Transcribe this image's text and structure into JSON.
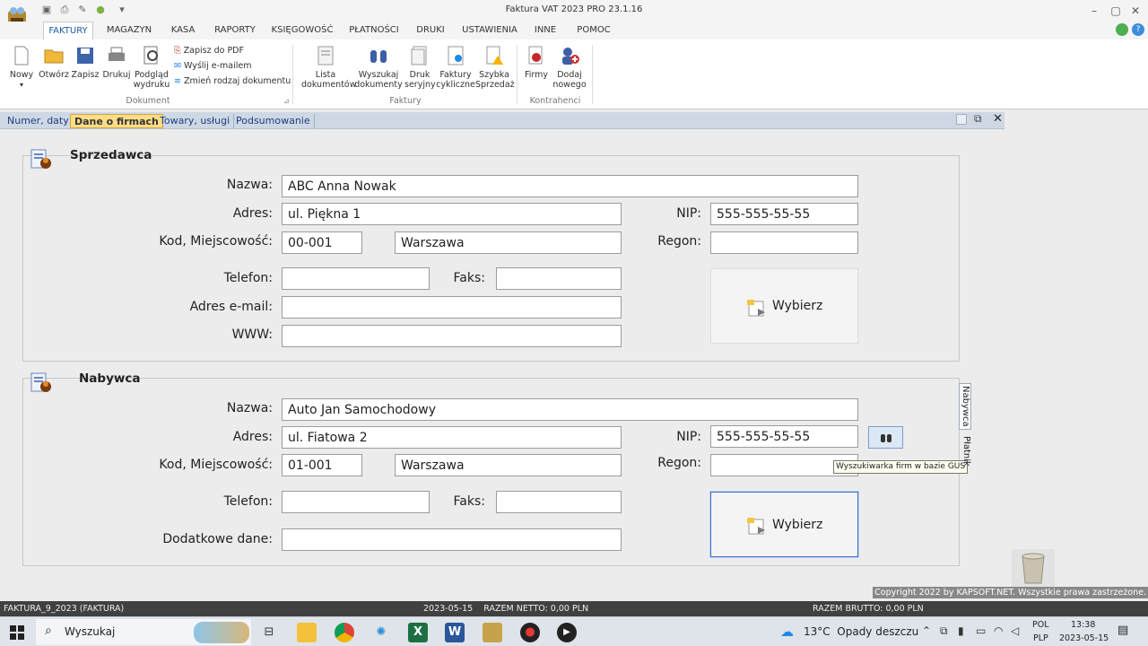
{
  "window": {
    "title": "Faktura VAT 2023 PRO 23.1.16"
  },
  "menu": [
    "FAKTURY",
    "MAGAZYN",
    "KASA",
    "RAPORTY",
    "KSIĘGOWOŚĆ",
    "PŁATNOŚCI",
    "DRUKI",
    "USTAWIENIA",
    "INNE",
    "POMOC"
  ],
  "ribbon": {
    "dokument": {
      "group_label": "Dokument",
      "buttons": [
        "Nowy",
        "Otwórz",
        "Zapisz",
        "Drukuj",
        "Podgląd wydruku"
      ],
      "small": [
        "Zapisz do PDF",
        "Wyślij e-mailem",
        "Zmień rodzaj dokumentu"
      ]
    },
    "faktury": {
      "group_label": "Faktury",
      "buttons": [
        "Lista dokumentów",
        "Wyszukaj dokumenty",
        "Druk seryjny",
        "Faktury cykliczne",
        "Szybka Sprzedaż"
      ]
    },
    "kontrahenci": {
      "group_label": "Kontrahenci",
      "buttons": [
        "Firmy",
        "Dodaj nowego"
      ]
    }
  },
  "tabs": [
    "Numer, daty",
    "Dane o firmach",
    "Towary, usługi",
    "Podsumowanie"
  ],
  "sprzedawca": {
    "heading": "Sprzedawca",
    "labels": {
      "nazwa": "Nazwa:",
      "adres": "Adres:",
      "kod": "Kod, Miejscowość:",
      "nip": "NIP:",
      "regon": "Regon:",
      "telefon": "Telefon:",
      "faks": "Faks:",
      "email": "Adres e-mail:",
      "www": "WWW:"
    },
    "values": {
      "nazwa": "ABC Anna Nowak",
      "adres": "ul. Piękna 1",
      "kod": "00-001",
      "miasto": "Warszawa",
      "nip": "555-555-55-55",
      "regon": "",
      "telefon": "",
      "faks": "",
      "email": "",
      "www": ""
    },
    "select_button": "Wybierz"
  },
  "nabywca": {
    "heading": "Nabywca",
    "labels": {
      "nazwa": "Nazwa:",
      "adres": "Adres:",
      "kod": "Kod, Miejscowość:",
      "nip": "NIP:",
      "regon": "Regon:",
      "telefon": "Telefon:",
      "faks": "Faks:",
      "dodatkowe": "Dodatkowe dane:"
    },
    "values": {
      "nazwa": "Auto Jan Samochodowy",
      "adres": "ul. Fiatowa 2",
      "kod": "01-001",
      "miasto": "Warszawa",
      "nip": "555-555-55-55",
      "regon": "",
      "telefon": "",
      "faks": "",
      "dodatkowe": ""
    },
    "select_button": "Wybierz",
    "gus_tooltip": "Wyszukiwarka firm w bazie GUS"
  },
  "side_tabs": [
    "Nabywca",
    "Płatnik"
  ],
  "copyright": "Copyright 2022 by KAPSOFT.NET. Wszystkie prawa zastrzeżone.",
  "status": {
    "document": "FAKTURA_9_2023 (FAKTURA)",
    "date_netto": "2023-05-15    RAZEM NETTO: 0,00 PLN",
    "brutto": "RAZEM BRUTTO: 0,00 PLN"
  },
  "taskbar": {
    "search": "Wyszukaj",
    "weather": "13°C  Opady deszczu",
    "lang1": "POL",
    "lang2": "PLP",
    "time": "13:38",
    "date": "2023-05-15"
  }
}
